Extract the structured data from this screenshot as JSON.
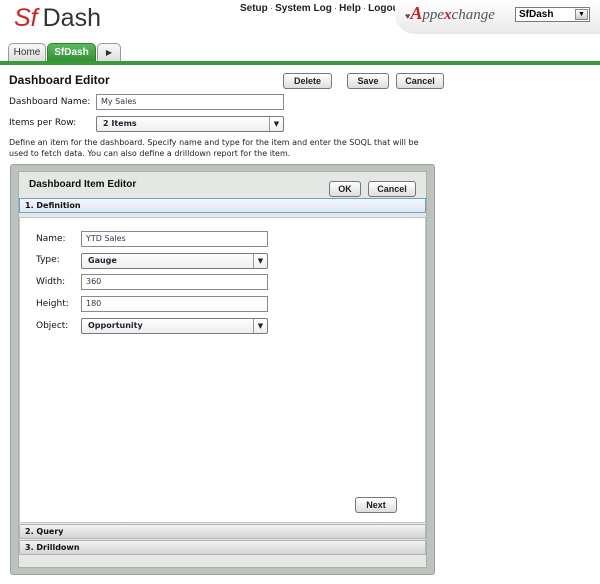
{
  "header": {
    "logo_sf": "Sf",
    "logo_dash": "Dash",
    "links": [
      "Setup",
      "System Log",
      "Help",
      "Logout"
    ],
    "appexchange_prefix": "♥",
    "appexchange_a": "A",
    "appexchange_mid": "ppe",
    "appexchange_x": "x",
    "appexchange_end": "change",
    "app_selector_value": "SfDash"
  },
  "tabs": {
    "home": "Home",
    "active": "SfDash",
    "more": "▶"
  },
  "editor": {
    "title": "Dashboard Editor",
    "delete_label": "Delete",
    "save_label": "Save",
    "cancel_label": "Cancel",
    "name_label": "Dashboard Name:",
    "name_value": "My Sales",
    "items_label": "Items per Row:",
    "items_value": "2 Items",
    "description": "Define an item for the dashboard. Specify name and type for the item and enter the SOQL that will be used to fetch data. You can also define a drilldown report for the item."
  },
  "item_editor": {
    "title": "Dashboard Item Editor",
    "ok_label": "OK",
    "cancel_label": "Cancel",
    "sections": [
      "1. Definition",
      "2. Query",
      "3. Drilldown"
    ],
    "fields": {
      "name_label": "Name:",
      "name_value": "YTD Sales",
      "type_label": "Type:",
      "type_value": "Gauge",
      "width_label": "Width:",
      "width_value": "360",
      "height_label": "Height:",
      "height_value": "180",
      "object_label": "Object:",
      "object_value": "Opportunity"
    },
    "next_label": "Next"
  },
  "icons": {
    "dropdown": "chevron-down-icon",
    "tab_more": "triangle-right-icon"
  },
  "colors": {
    "brand_red": "#d41f1f",
    "tab_green": "#3a9a3a"
  }
}
